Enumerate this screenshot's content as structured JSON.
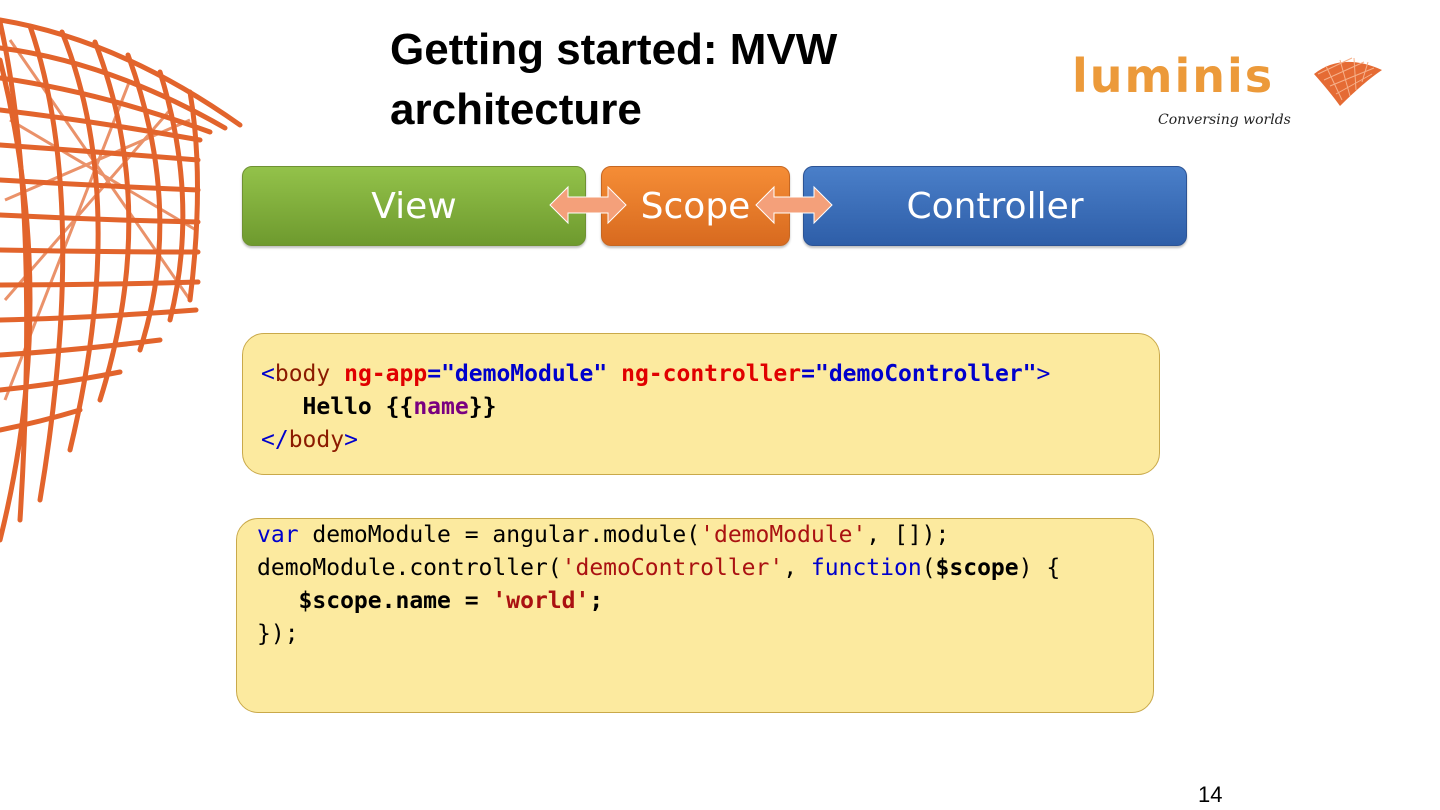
{
  "slide": {
    "title_line1": "Getting started: MVW",
    "title_line2": "architecture",
    "page_number": "14"
  },
  "logo": {
    "wordmark": "luminis",
    "tagline": "Conversing worlds"
  },
  "diagram": {
    "view_label": "View",
    "scope_label": "Scope",
    "controller_label": "Controller",
    "colors": {
      "view": "#7fae3c",
      "scope": "#e97a28",
      "controller": "#3a6db7",
      "arrow": "#f4a07a"
    }
  },
  "html_code": {
    "l1_open": "<",
    "l1_tag": "body",
    "l1_attr1": "ng-app",
    "l1_eq1": "=",
    "l1_val1": "\"demoModule\"",
    "l1_attr2": "ng-controller",
    "l1_eq2": "=",
    "l1_val2": "\"demoController\"",
    "l1_close": ">",
    "l2_text": "Hello {{",
    "l2_expr": "name",
    "l2_end": "}}",
    "l3_open": "</",
    "l3_tag": "body",
    "l3_close": ">"
  },
  "js_code": {
    "l1_kw": "var",
    "l1_rest": " demoModule = angular.module(",
    "l1_str": "'demoModule'",
    "l1_end": ", []);",
    "l2_a": "demoModule.controller(",
    "l2_str": "'demoController'",
    "l2_b": ", ",
    "l2_kw": "function",
    "l2_c": "(",
    "l2_param": "$scope",
    "l2_d": ") {",
    "l3_a": "$scope.name = ",
    "l3_str": "'world'",
    "l3_b": ";",
    "l4": "});"
  }
}
